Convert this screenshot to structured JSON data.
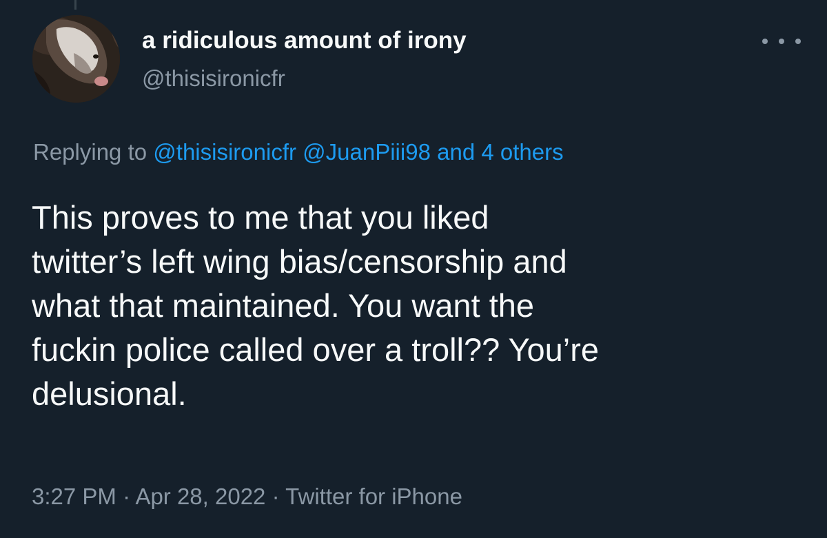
{
  "author": {
    "display_name": "a ridiculous amount of irony",
    "handle": "@thisisironicfr",
    "avatar_icon": "dog-avatar"
  },
  "more_icon": "more-dots-icon",
  "reply_context": {
    "prefix": "Replying to",
    "mention_1": "@thisisironicfr",
    "mention_2": "@JuanPiii98",
    "others": "and 4 others"
  },
  "tweet": {
    "line_1": "This proves to me that you liked",
    "line_2": "twitter’s left wing bias/censorship and",
    "line_3": "what that maintained. You want the",
    "line_4": "fuckin police called over a troll?? You’re",
    "line_5": "delusional."
  },
  "meta": {
    "time": "3:27 PM",
    "sep_1": "·",
    "date": "Apr 28, 2022",
    "sep_2": "·",
    "source": "Twitter for iPhone"
  },
  "colors": {
    "background": "#15202b",
    "text": "#f7f9f9",
    "secondary": "#8b98a5",
    "link": "#1d9bf0"
  }
}
